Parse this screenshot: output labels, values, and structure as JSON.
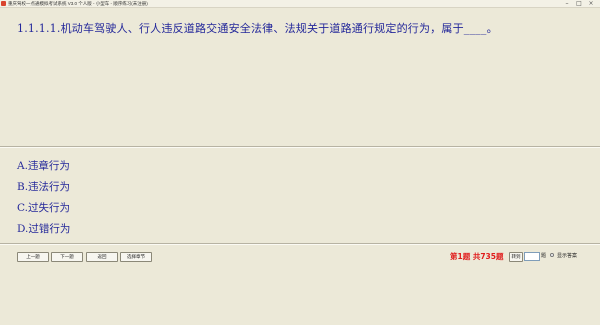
{
  "window": {
    "title": "重庆驾校一点通模拟考试系统 V3.0 个人版 - 小型车 - 顺序练习(未注册)",
    "minimize_glyph": "–",
    "maximize_glyph": "□",
    "close_glyph": "×"
  },
  "question": {
    "text": "1.1.1.1.机动车驾驶人、行人违反道路交通安全法律、法规关于道路通行规定的行为，属于____。"
  },
  "options": [
    {
      "label": "A.违章行为"
    },
    {
      "label": "B.违法行为"
    },
    {
      "label": "C.过失行为"
    },
    {
      "label": "D.过错行为"
    }
  ],
  "controls": {
    "prev_label": "上一题",
    "next_label": "下一题",
    "back_label": "返回",
    "chapter_label": "选择章节",
    "progress_text": "第1题  共735题",
    "goto_label": "转到",
    "jump_value": "",
    "jump_suffix": "题",
    "show_answer_label": "显示答案",
    "show_answer_checked": false
  },
  "colors": {
    "background": "#ece9d8",
    "question_text": "#24289a",
    "progress_text": "#e01c1c"
  }
}
